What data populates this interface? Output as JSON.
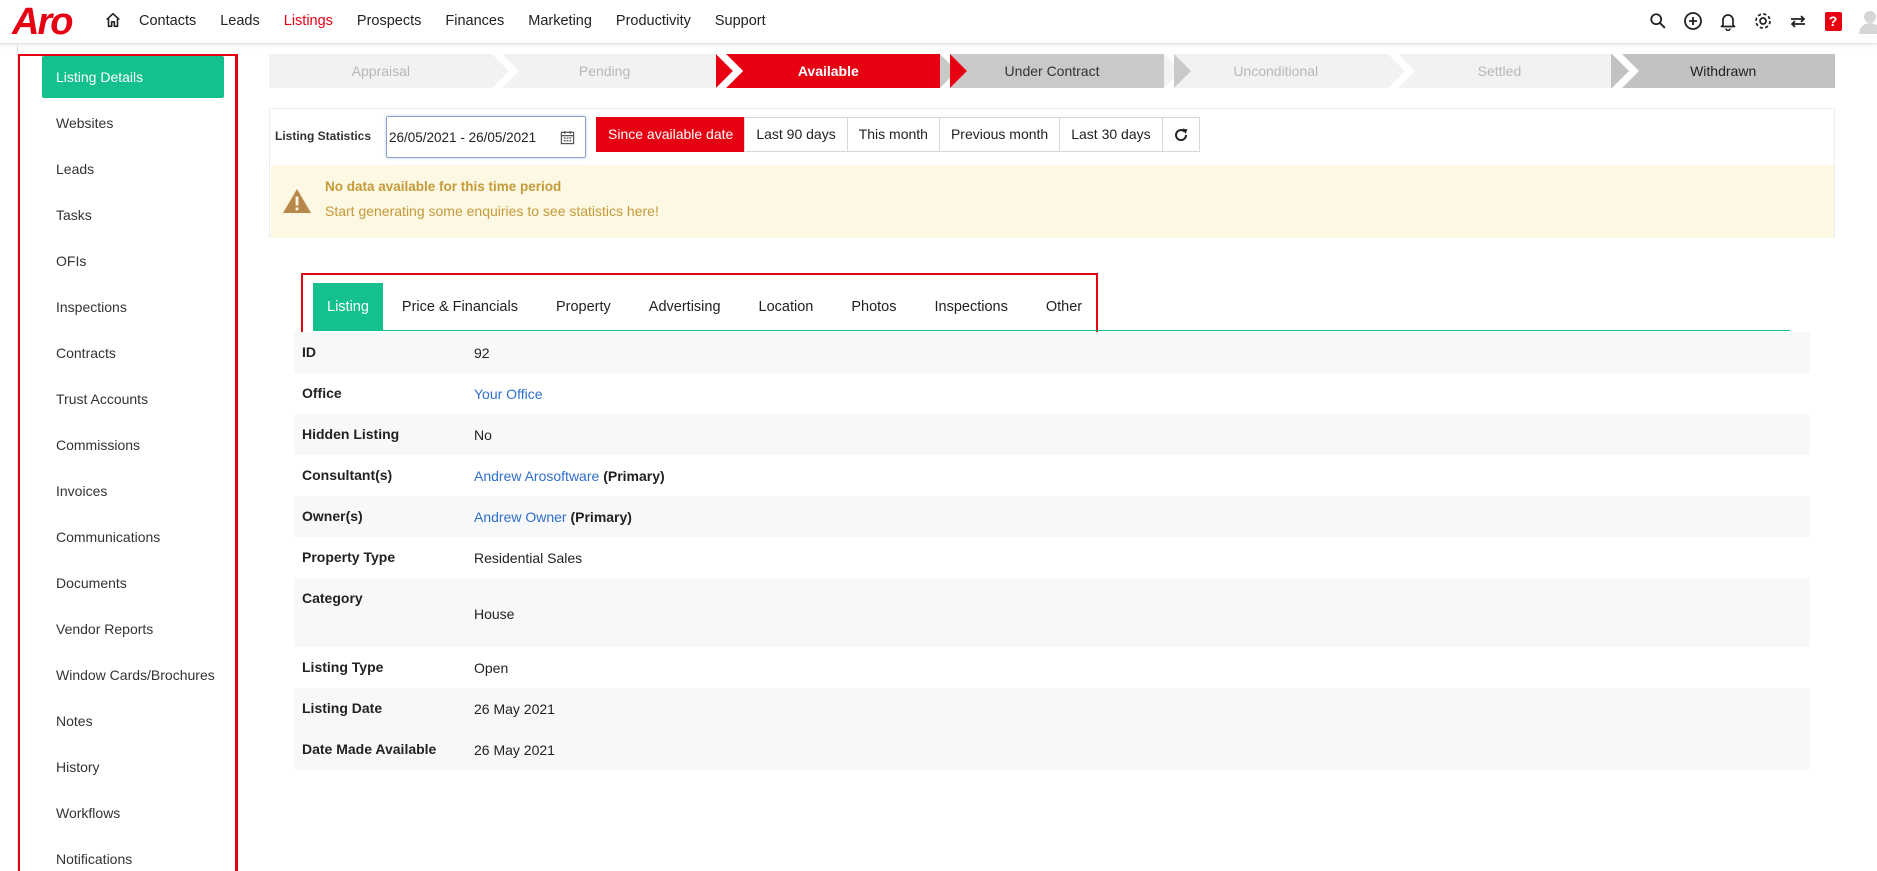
{
  "logo": "Aro",
  "nav": {
    "items": [
      "Contacts",
      "Leads",
      "Listings",
      "Prospects",
      "Finances",
      "Marketing",
      "Productivity",
      "Support"
    ],
    "active": "Listings"
  },
  "top_icons": [
    "search-icon",
    "add-circle-icon",
    "bell-icon",
    "gear-icon",
    "swap-icon",
    "help-icon",
    "avatar-icon"
  ],
  "help_glyph": "?",
  "sidebar": {
    "items": [
      "Listing Details",
      "Websites",
      "Leads",
      "Tasks",
      "OFIs",
      "Inspections",
      "Contracts",
      "Trust Accounts",
      "Commissions",
      "Invoices",
      "Communications",
      "Documents",
      "Vendor Reports",
      "Window Cards/Brochures",
      "Notes",
      "History",
      "Workflows",
      "Notifications"
    ],
    "active": "Listing Details"
  },
  "status_stages": [
    "Appraisal",
    "Pending",
    "Available",
    "Under Contract",
    "Unconditional",
    "Settled",
    "Withdrawn"
  ],
  "status_active": "Available",
  "stats": {
    "label": "Listing Statistics",
    "date_range": "26/05/2021 - 26/05/2021",
    "buttons": [
      "Since available date",
      "Last 90 days",
      "This month",
      "Previous month",
      "Last 30 days"
    ],
    "active_button": "Since available date",
    "warning_title": "No data available for this time period",
    "warning_text": "Start generating some enquiries to see statistics here!"
  },
  "tabs": [
    "Listing",
    "Price & Financials",
    "Property",
    "Advertising",
    "Location",
    "Photos",
    "Inspections",
    "Other"
  ],
  "active_tab": "Listing",
  "details": {
    "id": {
      "label": "ID",
      "value": "92"
    },
    "office": {
      "label": "Office",
      "value": "Your Office"
    },
    "hidden": {
      "label": "Hidden Listing",
      "value": "No"
    },
    "consultants": {
      "label": "Consultant(s)",
      "name": "Andrew Arosoftware",
      "role": "(Primary)"
    },
    "owners": {
      "label": "Owner(s)",
      "name": "Andrew Owner",
      "role": "(Primary)"
    },
    "property_type": {
      "label": "Property Type",
      "value": "Residential Sales"
    },
    "category": {
      "label": "Category",
      "value": "House"
    },
    "listing_type": {
      "label": "Listing Type",
      "value": "Open"
    },
    "listing_date": {
      "label": "Listing Date",
      "value": "26 May 2021"
    },
    "date_available": {
      "label": "Date Made Available",
      "value": "26 May 2021"
    }
  },
  "colors": {
    "brand_red": "#e60012",
    "active_green": "#14c08e",
    "link_blue": "#2f6fcc",
    "warning_bg": "#fcf8e3",
    "warning_text": "#c59a3a"
  }
}
